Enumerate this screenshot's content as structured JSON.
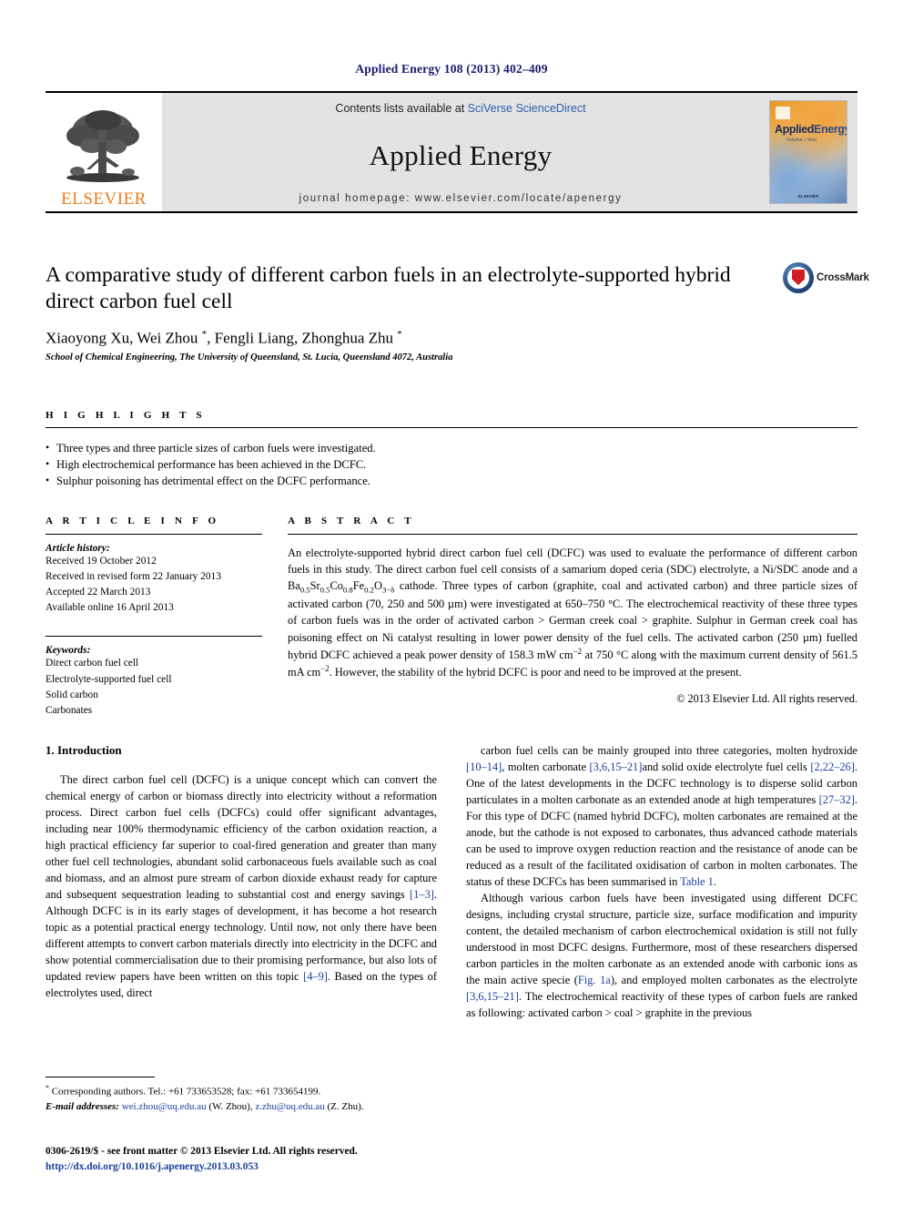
{
  "running_head": "Applied Energy 108 (2013) 402–409",
  "banner": {
    "publisher_name": "ELSEVIER",
    "publisher_logo_icon": "elsevier-tree-icon",
    "contents_prefix": "Contents lists available at ",
    "contents_link": "SciVerse ScienceDirect",
    "journal_name": "Applied Energy",
    "homepage_line": "journal homepage: www.elsevier.com/locate/apenergy",
    "cover": {
      "title_first": "Applied",
      "title_second": "Energy",
      "subtitle": "Volume  |  Year",
      "footer": "ELSEVIER"
    }
  },
  "article": {
    "title": "A comparative study of different carbon fuels in an electrolyte-supported hybrid direct carbon fuel cell",
    "authors_html": "Xiaoyong Xu, Wei Zhou <sup>*</sup>, Fengli Liang, Zhonghua Zhu <sup>*</sup>",
    "affiliation": "School of Chemical Engineering, The University of Queensland, St. Lucia, Queensland 4072, Australia",
    "crossmark_label": "CrossMark"
  },
  "highlights": {
    "heading": "H I G H L I G H T S",
    "items": [
      "Three types and three particle sizes of carbon fuels were investigated.",
      "High electrochemical performance has been achieved in the DCFC.",
      "Sulphur poisoning has detrimental effect on the DCFC performance."
    ]
  },
  "article_info": {
    "heading": "A R T I C L E    I N F O",
    "history_label": "Article history:",
    "history": [
      "Received 19 October 2012",
      "Received in revised form 22 January 2013",
      "Accepted 22 March 2013",
      "Available online 16 April 2013"
    ],
    "keywords_label": "Keywords:",
    "keywords": [
      "Direct carbon fuel cell",
      "Electrolyte-supported fuel cell",
      "Solid carbon",
      "Carbonates"
    ]
  },
  "abstract": {
    "heading": "A B S T R A C T",
    "text_html": "An electrolyte-supported hybrid direct carbon fuel cell (DCFC) was used to evaluate the performance of different carbon fuels in this study. The direct carbon fuel cell consists of a samarium doped ceria (SDC) electrolyte, a Ni/SDC anode and a Ba<sub>0.5</sub>Sr<sub>0.5</sub>Co<sub>0.8</sub>Fe<sub>0.2</sub>O<sub>3&minus;&delta;</sub> cathode. Three types of carbon (graphite, coal and activated carbon) and three particle sizes of activated carbon (70, 250 and 500 &micro;m) were investigated at 650&ndash;750 &deg;C. The electrochemical reactivity of these three types of carbon fuels was in the order of activated carbon &gt; German creek coal &gt; graphite. Sulphur in German creek coal has poisoning effect on Ni catalyst resulting in lower power density of the fuel cells. The activated carbon (250 &micro;m) fuelled hybrid DCFC achieved a peak power density of 158.3 mW cm<sup>&minus;2</sup> at 750 &deg;C along with the maximum current density of 561.5 mA cm<sup>&minus;2</sup>. However, the stability of the hybrid DCFC is poor and need to be improved at the present.",
    "copyright": "© 2013 Elsevier Ltd. All rights reserved."
  },
  "body": {
    "section_title": "1. Introduction",
    "left_paragraph_html": "The direct carbon fuel cell (DCFC) is a unique concept which can convert the chemical energy of carbon or biomass directly into electricity without a reformation process. Direct carbon fuel cells (DCFCs) could offer significant advantages, including near 100% thermodynamic efficiency of the carbon oxidation reaction, a high practical efficiency far superior to coal-fired generation and greater than many other fuel cell technologies, abundant solid carbonaceous fuels available such as coal and biomass, and an almost pure stream of carbon dioxide exhaust ready for capture and subsequent sequestration leading to substantial cost and energy savings <span class=\"ref\">[1&ndash;3]</span>. Although DCFC is in its early stages of development, it has become a hot research topic as a potential practical energy technology. Until now, not only there have been different attempts to convert carbon materials directly into electricity in the DCFC and show potential commercialisation due to their promising performance, but also lots of updated review papers have been written on this topic <span class=\"ref\">[4&ndash;9]</span>. Based on the types of electrolytes used, direct",
    "right_paragraph_1_html": "carbon fuel cells can be mainly grouped into three categories, molten hydroxide <span class=\"ref\">[10&ndash;14]</span>, molten carbonate <span class=\"ref\">[3,6,15&ndash;21]</span>and solid oxide electrolyte fuel cells <span class=\"ref\">[2,22&ndash;26]</span>. One of the latest developments in the DCFC technology is to disperse solid carbon particulates in a molten carbonate as an extended anode at high temperatures <span class=\"ref\">[27&ndash;32]</span>. For this type of DCFC (named hybrid DCFC), molten carbonates are remained at the anode, but the cathode is not exposed to carbonates, thus advanced cathode materials can be used to improve oxygen reduction reaction and the resistance of anode can be reduced as a result of the facilitated oxidisation of carbon in molten carbonates. The status of these DCFCs has been summarised in <span class=\"ref\">Table 1</span>.",
    "right_paragraph_2_html": "Although various carbon fuels have been investigated using different DCFC designs, including crystal structure, particle size, surface modification and impurity content, the detailed mechanism of carbon electrochemical oxidation is still not fully understood in most DCFC designs. Furthermore, most of these researchers dispersed carbon particles in the molten carbonate as an extended anode with carbonic ions as the main active specie (<span class=\"ref\">Fig. 1a</span>), and employed molten carbonates as the electrolyte <span class=\"ref\">[3,6,15&ndash;21]</span>. The electrochemical reactivity of these types of carbon fuels are ranked as following: activated carbon &gt; coal &gt; graphite in the previous"
  },
  "footnotes": {
    "corresponding_html": "<sup>*</sup> Corresponding authors. Tel.: +61 733653528; fax: +61 733654199.",
    "emails_html": "<em>E-mail addresses:</em> <span class=\"mail\">wei.zhou@uq.edu.au</span> (W. Zhou), <span class=\"mail\">z.zhu@uq.edu.au</span> (Z. Zhu).",
    "issn_line": "0306-2619/$ - see front matter © 2013 Elsevier Ltd. All rights reserved.",
    "doi": "http://dx.doi.org/10.1016/j.apenergy.2013.03.053"
  }
}
